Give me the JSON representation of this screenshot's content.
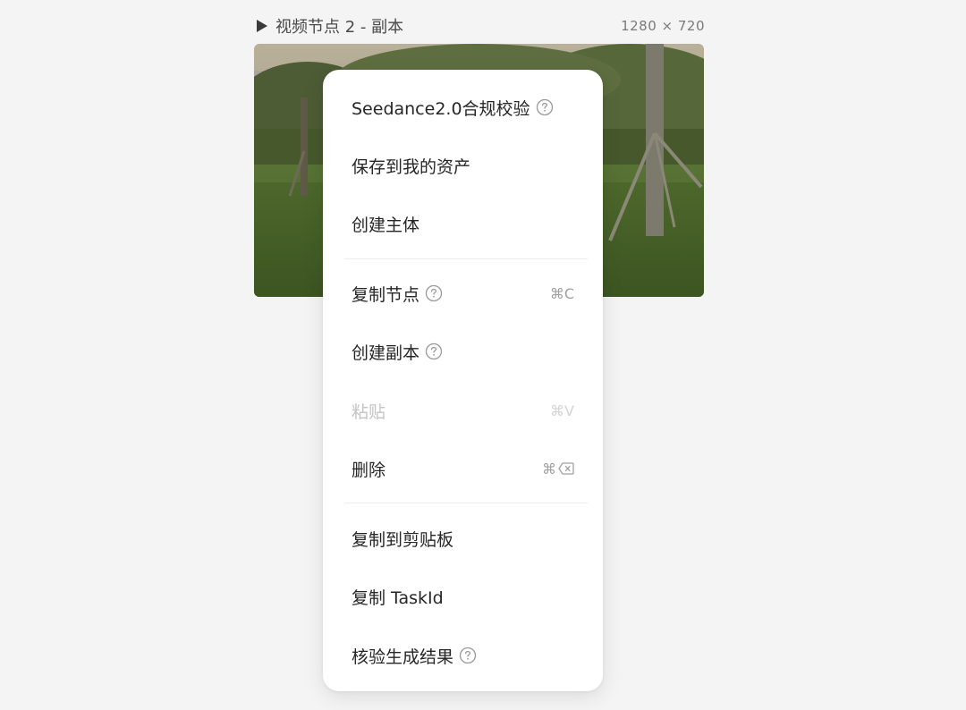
{
  "node": {
    "title": "视频节点 2 - 副本",
    "size": "1280 × 720",
    "icon": "play-icon"
  },
  "menu": {
    "groups": [
      [
        {
          "label": "Seedance2.0合规校验",
          "help": true,
          "shortcut": "",
          "disabled": false
        },
        {
          "label": "保存到我的资产",
          "help": false,
          "shortcut": "",
          "disabled": false
        },
        {
          "label": "创建主体",
          "help": false,
          "shortcut": "",
          "disabled": false
        }
      ],
      [
        {
          "label": "复制节点",
          "help": true,
          "shortcut": "⌘C",
          "disabled": false
        },
        {
          "label": "创建副本",
          "help": true,
          "shortcut": "",
          "disabled": false
        },
        {
          "label": "粘贴",
          "help": false,
          "shortcut": "⌘V",
          "disabled": true
        },
        {
          "label": "删除",
          "help": false,
          "shortcut": "⌘",
          "shortcut_icon": "delete-key-icon",
          "disabled": false
        }
      ],
      [
        {
          "label": "复制到剪贴板",
          "help": false,
          "shortcut": "",
          "disabled": false
        },
        {
          "label": "复制 TaskId",
          "help": false,
          "shortcut": "",
          "disabled": false
        },
        {
          "label": "核验生成结果",
          "help": true,
          "shortcut": "",
          "disabled": false
        }
      ]
    ]
  },
  "colors": {
    "background": "#f4f4f4",
    "menu_bg": "#ffffff",
    "text": "#262626",
    "disabled_text": "#c4c4c4",
    "muted": "#a0a0a0"
  }
}
